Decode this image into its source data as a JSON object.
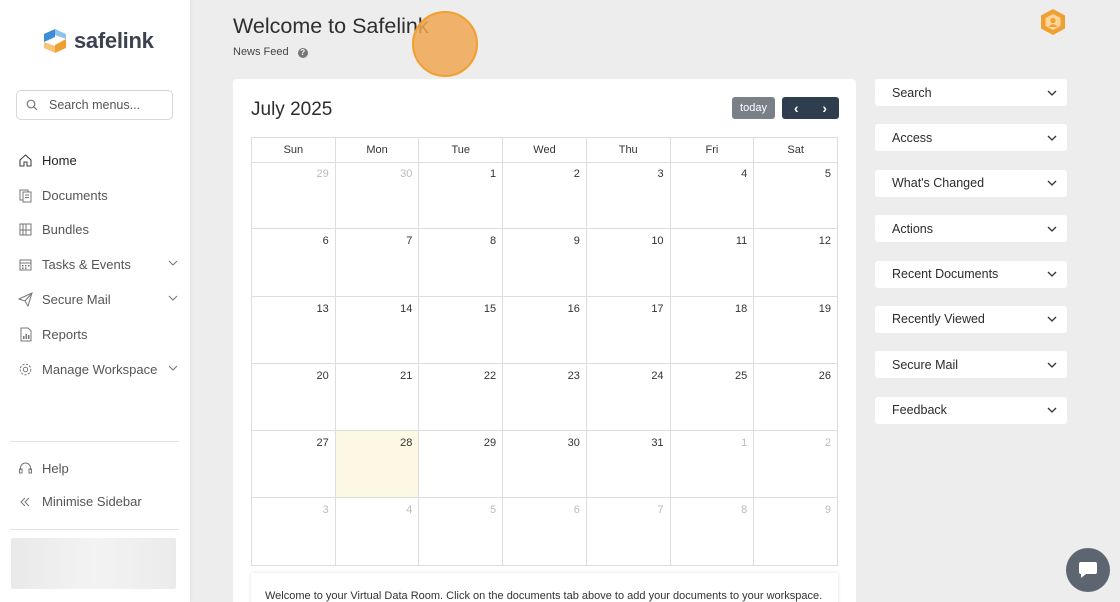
{
  "sidebar": {
    "logo_text": "safelink",
    "search_placeholder": "Search menus...",
    "nav": [
      {
        "label": "Home",
        "icon": "home-icon",
        "active": true,
        "expandable": false
      },
      {
        "label": "Documents",
        "icon": "documents-icon",
        "expandable": false
      },
      {
        "label": "Bundles",
        "icon": "bundles-icon",
        "expandable": false
      },
      {
        "label": "Tasks & Events",
        "icon": "calendar-icon",
        "expandable": true
      },
      {
        "label": "Secure Mail",
        "icon": "send-icon",
        "expandable": true
      },
      {
        "label": "Reports",
        "icon": "reports-icon",
        "expandable": false
      },
      {
        "label": "Manage Workspace",
        "icon": "gear-icon",
        "expandable": true
      }
    ],
    "bottom": [
      {
        "label": "Help",
        "icon": "headset-icon"
      },
      {
        "label": "Minimise Sidebar",
        "icon": "double-chevron-left-icon"
      }
    ]
  },
  "header": {
    "title": "Welcome to Safelink",
    "subnav_label": "News Feed",
    "help_glyph": "?"
  },
  "calendar": {
    "month_title": "July 2025",
    "today_label": "today",
    "prev_glyph": "‹",
    "next_glyph": "›",
    "weekdays": [
      "Sun",
      "Mon",
      "Tue",
      "Wed",
      "Thu",
      "Fri",
      "Sat"
    ],
    "weeks": [
      [
        {
          "d": "29",
          "o": true
        },
        {
          "d": "30",
          "o": true
        },
        {
          "d": "1"
        },
        {
          "d": "2"
        },
        {
          "d": "3"
        },
        {
          "d": "4"
        },
        {
          "d": "5"
        }
      ],
      [
        {
          "d": "6"
        },
        {
          "d": "7"
        },
        {
          "d": "8"
        },
        {
          "d": "9"
        },
        {
          "d": "10"
        },
        {
          "d": "11"
        },
        {
          "d": "12"
        }
      ],
      [
        {
          "d": "13"
        },
        {
          "d": "14"
        },
        {
          "d": "15"
        },
        {
          "d": "16"
        },
        {
          "d": "17"
        },
        {
          "d": "18"
        },
        {
          "d": "19"
        }
      ],
      [
        {
          "d": "20"
        },
        {
          "d": "21"
        },
        {
          "d": "22"
        },
        {
          "d": "23"
        },
        {
          "d": "24"
        },
        {
          "d": "25"
        },
        {
          "d": "26"
        }
      ],
      [
        {
          "d": "27"
        },
        {
          "d": "28",
          "today": true
        },
        {
          "d": "29"
        },
        {
          "d": "30"
        },
        {
          "d": "31"
        },
        {
          "d": "1",
          "o": true
        },
        {
          "d": "2",
          "o": true
        }
      ],
      [
        {
          "d": "3",
          "o": true
        },
        {
          "d": "4",
          "o": true
        },
        {
          "d": "5",
          "o": true
        },
        {
          "d": "6",
          "o": true
        },
        {
          "d": "7",
          "o": true
        },
        {
          "d": "8",
          "o": true
        },
        {
          "d": "9",
          "o": true
        }
      ]
    ],
    "welcome_message": "Welcome to your Virtual Data Room. Click on the documents tab above to add your documents to your workspace."
  },
  "panels": [
    "Search",
    "Access",
    "What's Changed",
    "Actions",
    "Recent Documents",
    "Recently Viewed",
    "Secure Mail",
    "Feedback"
  ],
  "colors": {
    "brand_orange": "#f0a030",
    "brand_blue": "#3b8ed6",
    "nav_dark": "#2f3e4e",
    "today_button": "#7a8088",
    "today_highlight": "#fdf8e4",
    "page_bg": "#ededed"
  }
}
